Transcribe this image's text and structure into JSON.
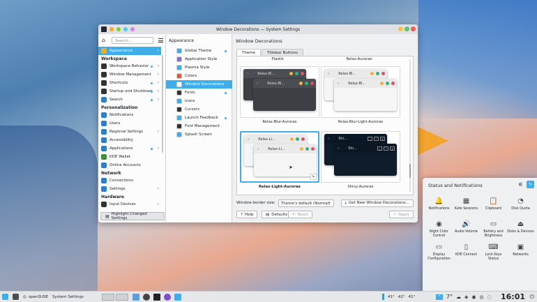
{
  "window": {
    "title": "Window Decorations — System Settings"
  },
  "sidebar": {
    "search_placeholder": "Search...",
    "items": [
      {
        "type": "item",
        "label": "Appearance",
        "sel": true,
        "color": "#e7b026",
        "chev": true
      },
      {
        "type": "head",
        "label": "Workspace"
      },
      {
        "type": "item",
        "label": "Workspace Behavior",
        "color": "#333",
        "bul": true,
        "chev": true
      },
      {
        "type": "item",
        "label": "Window Management",
        "color": "#333",
        "chev": true
      },
      {
        "type": "item",
        "label": "Shortcuts",
        "color": "#333",
        "bul": true,
        "chev": true
      },
      {
        "type": "item",
        "label": "Startup and Shutdown",
        "color": "#333",
        "bul": true,
        "chev": true
      },
      {
        "type": "item",
        "label": "Search",
        "color": "#2a7fd4",
        "bul": true,
        "chev": true
      },
      {
        "type": "head",
        "label": "Personalization"
      },
      {
        "type": "item",
        "label": "Notifications",
        "color": "#2a7fd4"
      },
      {
        "type": "item",
        "label": "Users",
        "color": "#2a7fd4"
      },
      {
        "type": "item",
        "label": "Regional Settings",
        "color": "#2a7fd4",
        "chev": true
      },
      {
        "type": "item",
        "label": "Accessibility",
        "color": "#2a7fd4"
      },
      {
        "type": "item",
        "label": "Applications",
        "color": "#2a7fd4",
        "bul": true,
        "chev": true
      },
      {
        "type": "item",
        "label": "KDE Wallet",
        "color": "#3a8f3a"
      },
      {
        "type": "item",
        "label": "Online Accounts",
        "color": "#2a7fd4"
      },
      {
        "type": "head",
        "label": "Network"
      },
      {
        "type": "item",
        "label": "Connections",
        "color": "#2a7fd4"
      },
      {
        "type": "item",
        "label": "Settings",
        "color": "#2a7fd4",
        "chev": true
      },
      {
        "type": "head",
        "label": "Hardware"
      },
      {
        "type": "item",
        "label": "Input Devices",
        "color": "#333",
        "chev": true
      }
    ],
    "highlight_label": "Highlight Changed Settings"
  },
  "sub": {
    "title": "Appearance",
    "items": [
      {
        "label": "Global Theme",
        "color": "#3daee9",
        "bul": true
      },
      {
        "label": "Application Style",
        "color": "#8a6dd0"
      },
      {
        "label": "Plasma Style",
        "color": "#3daee9"
      },
      {
        "label": "Colors",
        "color": "#e05a3a"
      },
      {
        "label": "Window Decorations",
        "color": "#fcfcfc",
        "sel": true
      },
      {
        "label": "Fonts",
        "color": "#333",
        "bul": true
      },
      {
        "label": "Icons",
        "color": "#3daee9"
      },
      {
        "label": "Cursors",
        "color": "#333"
      },
      {
        "label": "Launch Feedback",
        "color": "#3daee9",
        "bul": true
      },
      {
        "label": "Font Management",
        "color": "#333"
      },
      {
        "label": "Splash Screen",
        "color": "#3daee9"
      }
    ]
  },
  "main": {
    "title": "Window Decorations",
    "tabs": [
      "Theme",
      "Titlebar Buttons"
    ],
    "top_labels": [
      "Plastik",
      "Relax-Aurorae"
    ],
    "cards": [
      {
        "label": "Relax-Blur-Aurorae",
        "mini": "Relax-Bl...",
        "dark": true
      },
      {
        "label": "Relax-Blur-Light-Aurorae",
        "mini": "Relax-Bl...",
        "dark": false
      },
      {
        "label": "Relax-Light-Aurorae",
        "mini": "Relax-Li...",
        "dark": false,
        "sel": true
      },
      {
        "label": "Shiny-Aurorae",
        "mini": "Shi...",
        "dark": true,
        "shiny": true
      }
    ],
    "border_label": "Window border size:",
    "border_value": "Theme's default (Normal)",
    "get_new": "Get New Window Decorations...",
    "help": "Help",
    "defaults": "Defaults",
    "reset": "Reset",
    "apply": "Apply"
  },
  "tray": {
    "title": "Status and Notifications",
    "items": [
      {
        "icon": "🔔",
        "label": "Notifications"
      },
      {
        "icon": "▦",
        "label": "Kate Sessions"
      },
      {
        "icon": "📋",
        "label": "Clipboard"
      },
      {
        "icon": "◔",
        "label": "Disk Quota"
      },
      {
        "icon": "◉",
        "label": "Night Color Control"
      },
      {
        "icon": "🔊",
        "label": "Audio Volume"
      },
      {
        "icon": "▭",
        "label": "Battery and Brightness"
      },
      {
        "icon": "⏏",
        "label": "Disks & Devices"
      },
      {
        "icon": "▭",
        "label": "Display Configuration"
      },
      {
        "icon": "▯",
        "label": "KDE Connect"
      },
      {
        "icon": "⌨",
        "label": "Lock Keys Status"
      },
      {
        "icon": "▣",
        "label": "Networks"
      }
    ]
  },
  "taskbar": {
    "distro": "openSUSE",
    "app": "System Settings",
    "temps": [
      "41°",
      "42°",
      "41°"
    ],
    "weather": "7°",
    "clock": "16:01"
  }
}
